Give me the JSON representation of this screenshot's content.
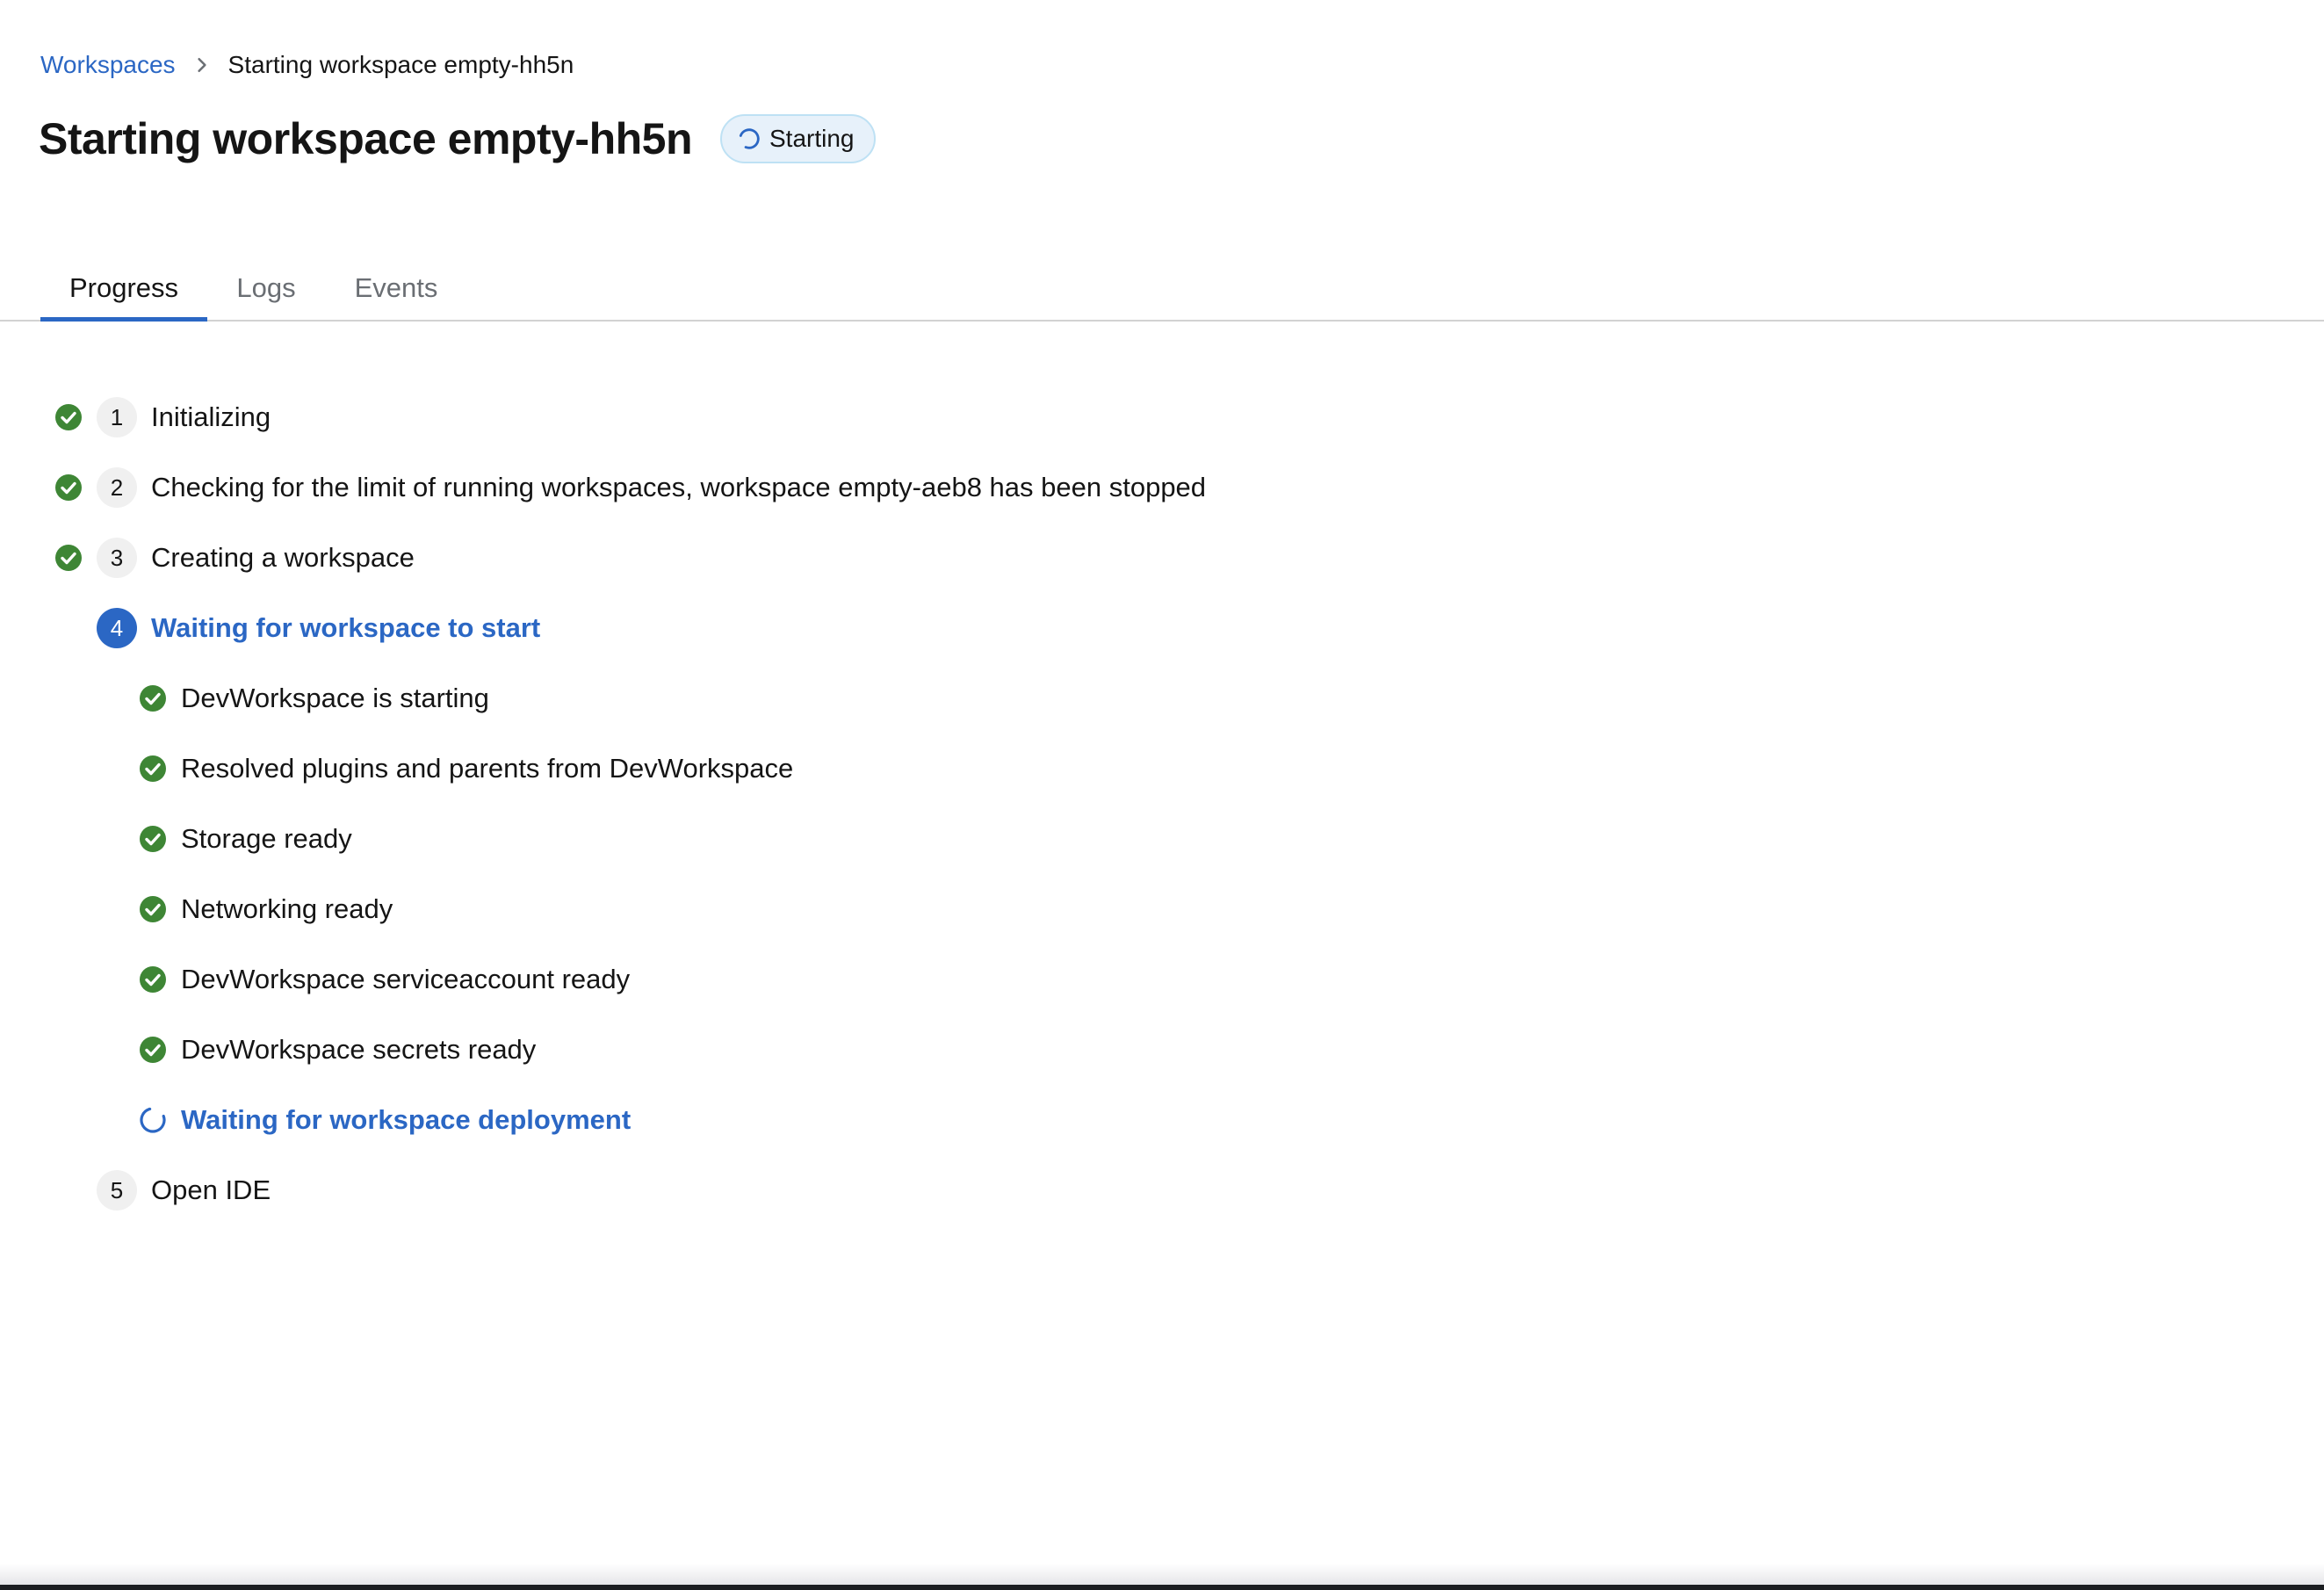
{
  "breadcrumb": {
    "root_label": "Workspaces",
    "current_label": "Starting workspace empty-hh5n"
  },
  "header": {
    "title": "Starting workspace empty-hh5n",
    "status_label": "Starting"
  },
  "tabs": [
    {
      "label": "Progress",
      "active": true
    },
    {
      "label": "Logs",
      "active": false
    },
    {
      "label": "Events",
      "active": false
    }
  ],
  "progress": {
    "steps": [
      {
        "number": "1",
        "label": "Initializing",
        "state": "done"
      },
      {
        "number": "2",
        "label": "Checking for the limit of running workspaces, workspace empty-aeb8 has been stopped",
        "state": "done"
      },
      {
        "number": "3",
        "label": "Creating a workspace",
        "state": "done"
      },
      {
        "number": "4",
        "label": "Waiting for workspace to start",
        "state": "current",
        "substeps": [
          {
            "label": "DevWorkspace is starting",
            "state": "done"
          },
          {
            "label": "Resolved plugins and parents from DevWorkspace",
            "state": "done"
          },
          {
            "label": "Storage ready",
            "state": "done"
          },
          {
            "label": "Networking ready",
            "state": "done"
          },
          {
            "label": "DevWorkspace serviceaccount ready",
            "state": "done"
          },
          {
            "label": "DevWorkspace secrets ready",
            "state": "done"
          },
          {
            "label": "Waiting for workspace deployment",
            "state": "in-progress"
          }
        ]
      },
      {
        "number": "5",
        "label": "Open IDE",
        "state": "pending"
      }
    ]
  },
  "icons": {
    "success": "check-circle-icon",
    "in_progress": "spinner-icon",
    "breadcrumb_separator": "chevron-right-icon"
  },
  "colors": {
    "link": "#2b67c4",
    "success": "#3e8635",
    "active_tab": "#2b67c4",
    "badge_bg": "#e7f1fa"
  }
}
